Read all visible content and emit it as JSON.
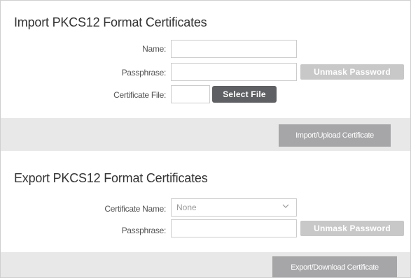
{
  "import_section": {
    "title": "Import PKCS12 Format Certificates",
    "name_label": "Name:",
    "name_value": "",
    "passphrase_label": "Passphrase:",
    "passphrase_value": "",
    "unmask_button": "Unmask Password",
    "certificate_file_label": "Certificate File:",
    "select_file_button": "Select File",
    "import_button": "Import/Upload Certificate"
  },
  "export_section": {
    "title": "Export PKCS12 Format Certificates",
    "certificate_name_label": "Certificate Name:",
    "certificate_name_selected": "None",
    "passphrase_label": "Passphrase:",
    "passphrase_value": "",
    "unmask_button": "Unmask Password",
    "export_button": "Export/Download Certificate"
  }
}
